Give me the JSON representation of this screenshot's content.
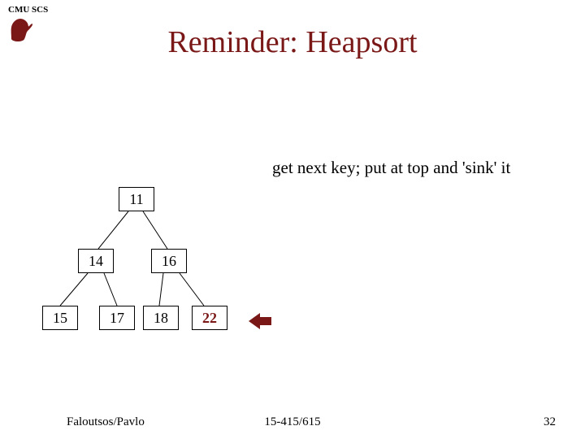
{
  "header": {
    "org": "CMU SCS"
  },
  "title": "Reminder: Heapsort",
  "step_text": "get next key; put at top and 'sink' it",
  "tree": {
    "n1": "11",
    "n2": "14",
    "n3": "16",
    "n4": "15",
    "n5": "17",
    "n6": "18",
    "n7": "22"
  },
  "footer": {
    "authors": "Faloutsos/Pavlo",
    "course": "15-415/615",
    "page": "32"
  },
  "colors": {
    "brand": "#7a1818"
  }
}
